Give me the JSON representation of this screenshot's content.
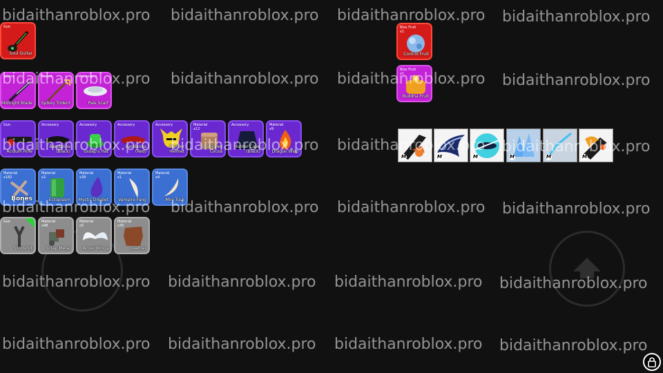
{
  "watermark": "bidaithanroblox.pro",
  "inventory": {
    "row1": [
      {
        "type": "Gun",
        "qty": "",
        "name": "Soul Guitar",
        "rarity": "mythical"
      }
    ],
    "row2": [
      {
        "type": "Sword",
        "qty": "",
        "name": "Midnight Blade",
        "rarity": "legendary"
      },
      {
        "type": "Sword",
        "qty": "",
        "name": "Spikey Trident",
        "rarity": "legendary"
      },
      {
        "type": "Accessory",
        "qty": "",
        "name": "Pale Scarf",
        "rarity": "legendary"
      }
    ],
    "row3": [
      {
        "type": "Gun",
        "qty": "",
        "name": "Acidum Rifle",
        "rarity": "rare"
      },
      {
        "type": "Accessory",
        "qty": "",
        "name": "Bandanna (Black)",
        "rarity": "rare"
      },
      {
        "type": "Accessory",
        "qty": "",
        "name": "Usoap's Hat",
        "rarity": "rare"
      },
      {
        "type": "Accessory",
        "qty": "",
        "name": "Bandanna (Red)",
        "rarity": "rare"
      },
      {
        "type": "Accessory",
        "qty": "",
        "name": "Warrior Helmet",
        "rarity": "rare"
      },
      {
        "type": "Material",
        "qty": "x12",
        "name": "Conjured Cocoa",
        "rarity": "rare"
      },
      {
        "type": "Accessory",
        "qty": "",
        "name": "Hunter Cape (Black)",
        "rarity": "rare"
      },
      {
        "type": "Material",
        "qty": "x9",
        "name": "Dragon Wisp",
        "rarity": "rare"
      }
    ],
    "row4": [
      {
        "type": "Material",
        "qty": "x182",
        "name": "Bones",
        "rarity": "uncommon"
      },
      {
        "type": "Material",
        "qty": "x2",
        "name": "Ectoplasm",
        "rarity": "uncommon"
      },
      {
        "type": "Material",
        "qty": "x39",
        "name": "Mystic Droplet",
        "rarity": "uncommon"
      },
      {
        "type": "Material",
        "qty": "x1",
        "name": "Vampire Fang",
        "rarity": "uncommon"
      },
      {
        "type": "Material",
        "qty": "x4",
        "name": "Mini Tusk",
        "rarity": "uncommon"
      }
    ],
    "row5": [
      {
        "type": "Gun",
        "qty": "",
        "name": "Slingshot",
        "rarity": "common"
      },
      {
        "type": "Material",
        "qty": "x48",
        "name": "Scrap Metal",
        "rarity": "common"
      },
      {
        "type": "Material",
        "qty": "x5",
        "name": "Angel Wings",
        "rarity": "common"
      },
      {
        "type": "Material",
        "qty": "x30",
        "name": "Leather",
        "rarity": "common"
      }
    ]
  },
  "fruits": [
    {
      "type": "Blox Fruit",
      "qty": "x1",
      "name": "Control Fruit",
      "rarity": "mythical"
    },
    {
      "type": "Blox Fruit",
      "qty": "x1",
      "name": "Buddha Fruit",
      "rarity": "legendary"
    }
  ],
  "skills": [
    {
      "icon": "dark-blade-skill-icon",
      "badge": "M"
    },
    {
      "icon": "blue-wave-skill-icon",
      "badge": "M"
    },
    {
      "icon": "cyan-slash-skill-icon",
      "badge": "M"
    },
    {
      "icon": "ice-burst-skill-icon",
      "badge": "M"
    },
    {
      "icon": "lightning-slash-skill-icon",
      "badge": "M"
    },
    {
      "icon": "fire-blade-skill-icon",
      "badge": "M"
    }
  ],
  "colors": {
    "mythical": "#d51a1a",
    "legendary": "#c322d6",
    "rare": "#6a28d0",
    "uncommon": "#3b6fd2",
    "common": "#8d8d8d",
    "background": "#111111"
  }
}
